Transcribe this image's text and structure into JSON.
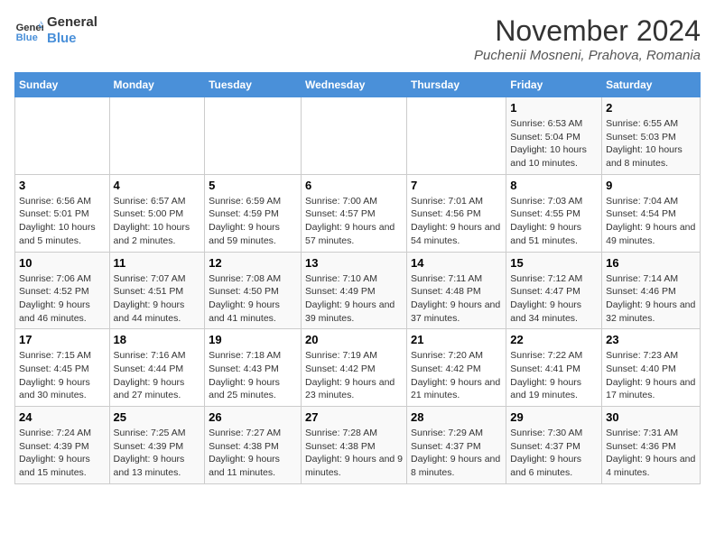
{
  "header": {
    "logo_line1": "General",
    "logo_line2": "Blue",
    "month_year": "November 2024",
    "location": "Puchenii Mosneni, Prahova, Romania"
  },
  "weekdays": [
    "Sunday",
    "Monday",
    "Tuesday",
    "Wednesday",
    "Thursday",
    "Friday",
    "Saturday"
  ],
  "weeks": [
    [
      {
        "day": "",
        "info": ""
      },
      {
        "day": "",
        "info": ""
      },
      {
        "day": "",
        "info": ""
      },
      {
        "day": "",
        "info": ""
      },
      {
        "day": "",
        "info": ""
      },
      {
        "day": "1",
        "info": "Sunrise: 6:53 AM\nSunset: 5:04 PM\nDaylight: 10 hours and 10 minutes."
      },
      {
        "day": "2",
        "info": "Sunrise: 6:55 AM\nSunset: 5:03 PM\nDaylight: 10 hours and 8 minutes."
      }
    ],
    [
      {
        "day": "3",
        "info": "Sunrise: 6:56 AM\nSunset: 5:01 PM\nDaylight: 10 hours and 5 minutes."
      },
      {
        "day": "4",
        "info": "Sunrise: 6:57 AM\nSunset: 5:00 PM\nDaylight: 10 hours and 2 minutes."
      },
      {
        "day": "5",
        "info": "Sunrise: 6:59 AM\nSunset: 4:59 PM\nDaylight: 9 hours and 59 minutes."
      },
      {
        "day": "6",
        "info": "Sunrise: 7:00 AM\nSunset: 4:57 PM\nDaylight: 9 hours and 57 minutes."
      },
      {
        "day": "7",
        "info": "Sunrise: 7:01 AM\nSunset: 4:56 PM\nDaylight: 9 hours and 54 minutes."
      },
      {
        "day": "8",
        "info": "Sunrise: 7:03 AM\nSunset: 4:55 PM\nDaylight: 9 hours and 51 minutes."
      },
      {
        "day": "9",
        "info": "Sunrise: 7:04 AM\nSunset: 4:54 PM\nDaylight: 9 hours and 49 minutes."
      }
    ],
    [
      {
        "day": "10",
        "info": "Sunrise: 7:06 AM\nSunset: 4:52 PM\nDaylight: 9 hours and 46 minutes."
      },
      {
        "day": "11",
        "info": "Sunrise: 7:07 AM\nSunset: 4:51 PM\nDaylight: 9 hours and 44 minutes."
      },
      {
        "day": "12",
        "info": "Sunrise: 7:08 AM\nSunset: 4:50 PM\nDaylight: 9 hours and 41 minutes."
      },
      {
        "day": "13",
        "info": "Sunrise: 7:10 AM\nSunset: 4:49 PM\nDaylight: 9 hours and 39 minutes."
      },
      {
        "day": "14",
        "info": "Sunrise: 7:11 AM\nSunset: 4:48 PM\nDaylight: 9 hours and 37 minutes."
      },
      {
        "day": "15",
        "info": "Sunrise: 7:12 AM\nSunset: 4:47 PM\nDaylight: 9 hours and 34 minutes."
      },
      {
        "day": "16",
        "info": "Sunrise: 7:14 AM\nSunset: 4:46 PM\nDaylight: 9 hours and 32 minutes."
      }
    ],
    [
      {
        "day": "17",
        "info": "Sunrise: 7:15 AM\nSunset: 4:45 PM\nDaylight: 9 hours and 30 minutes."
      },
      {
        "day": "18",
        "info": "Sunrise: 7:16 AM\nSunset: 4:44 PM\nDaylight: 9 hours and 27 minutes."
      },
      {
        "day": "19",
        "info": "Sunrise: 7:18 AM\nSunset: 4:43 PM\nDaylight: 9 hours and 25 minutes."
      },
      {
        "day": "20",
        "info": "Sunrise: 7:19 AM\nSunset: 4:42 PM\nDaylight: 9 hours and 23 minutes."
      },
      {
        "day": "21",
        "info": "Sunrise: 7:20 AM\nSunset: 4:42 PM\nDaylight: 9 hours and 21 minutes."
      },
      {
        "day": "22",
        "info": "Sunrise: 7:22 AM\nSunset: 4:41 PM\nDaylight: 9 hours and 19 minutes."
      },
      {
        "day": "23",
        "info": "Sunrise: 7:23 AM\nSunset: 4:40 PM\nDaylight: 9 hours and 17 minutes."
      }
    ],
    [
      {
        "day": "24",
        "info": "Sunrise: 7:24 AM\nSunset: 4:39 PM\nDaylight: 9 hours and 15 minutes."
      },
      {
        "day": "25",
        "info": "Sunrise: 7:25 AM\nSunset: 4:39 PM\nDaylight: 9 hours and 13 minutes."
      },
      {
        "day": "26",
        "info": "Sunrise: 7:27 AM\nSunset: 4:38 PM\nDaylight: 9 hours and 11 minutes."
      },
      {
        "day": "27",
        "info": "Sunrise: 7:28 AM\nSunset: 4:38 PM\nDaylight: 9 hours and 9 minutes."
      },
      {
        "day": "28",
        "info": "Sunrise: 7:29 AM\nSunset: 4:37 PM\nDaylight: 9 hours and 8 minutes."
      },
      {
        "day": "29",
        "info": "Sunrise: 7:30 AM\nSunset: 4:37 PM\nDaylight: 9 hours and 6 minutes."
      },
      {
        "day": "30",
        "info": "Sunrise: 7:31 AM\nSunset: 4:36 PM\nDaylight: 9 hours and 4 minutes."
      }
    ]
  ]
}
